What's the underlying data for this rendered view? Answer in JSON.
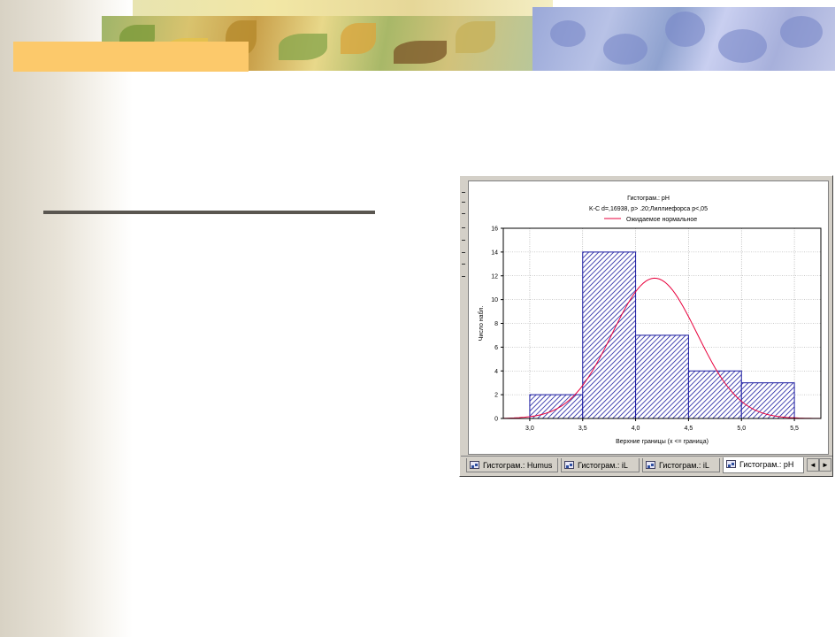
{
  "chart_data": {
    "type": "bar",
    "title": "Гистограм.: pH",
    "subtitle": "K-C d=,16938, p> .20;Лиллиефорса p<,05",
    "legend": [
      {
        "label": "Ожидаемое нормальное",
        "color": "#e8003c"
      }
    ],
    "legend_position": "top-center",
    "xlabel": "Верхние границы (x <= граница)",
    "ylabel": "Число набл.",
    "xlim": [
      2.75,
      5.75
    ],
    "ylim": [
      0,
      16
    ],
    "grid": true,
    "x_ticks": [
      "3,0",
      "3,5",
      "4,0",
      "4,5",
      "5,0",
      "5,5"
    ],
    "x_tick_values": [
      3.0,
      3.5,
      4.0,
      4.5,
      5.0,
      5.5
    ],
    "y_ticks": [
      "0",
      "2",
      "4",
      "6",
      "8",
      "10",
      "12",
      "14",
      "16"
    ],
    "y_tick_values": [
      0,
      2,
      4,
      6,
      8,
      10,
      12,
      14,
      16
    ],
    "bins": [
      {
        "from": 3.0,
        "to": 3.5,
        "value": 2
      },
      {
        "from": 3.5,
        "to": 4.0,
        "value": 14
      },
      {
        "from": 4.0,
        "to": 4.5,
        "value": 7
      },
      {
        "from": 4.5,
        "to": 5.0,
        "value": 4
      },
      {
        "from": 5.0,
        "to": 5.5,
        "value": 3
      }
    ],
    "bar_color": "#1a1aa0",
    "curve": {
      "name": "Ожидаемое нормальное",
      "mean": 4.18,
      "sd": 0.4,
      "peak": 11.8,
      "color": "#e8003c"
    }
  },
  "tabs": [
    {
      "label": "Гистограм.: Humus",
      "active": false
    },
    {
      "label": "Гистограм.: iL",
      "active": false
    },
    {
      "label": "Гистограм.: iL",
      "active": false
    },
    {
      "label": "Гистограм.: pH",
      "active": true
    }
  ],
  "scroll": {
    "left": "◄",
    "right": "►"
  },
  "colors": {
    "accent_orange": "#fcc96b",
    "rule": "#5a5650"
  }
}
